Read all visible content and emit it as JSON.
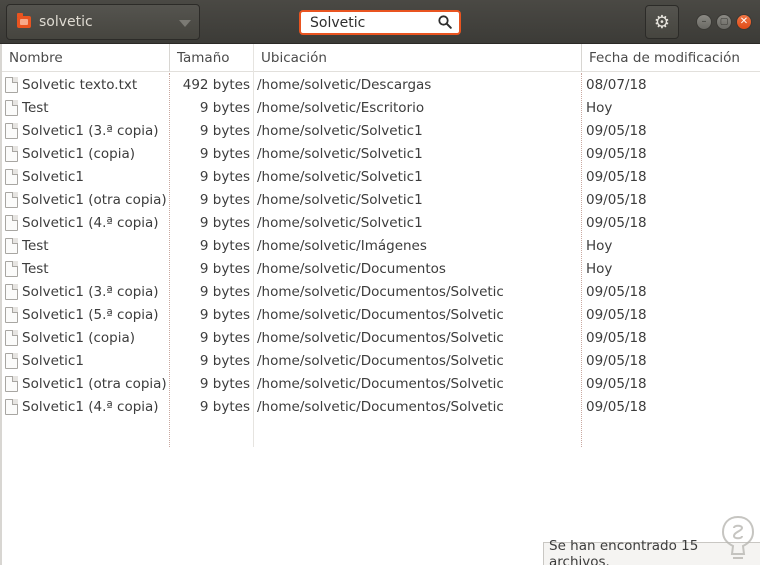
{
  "window": {
    "folder_label": "solvetic",
    "search_value": "Solvetic"
  },
  "columns": {
    "name": "Nombre",
    "size": "Tamaño",
    "location": "Ubicación",
    "modified": "Fecha de modificación"
  },
  "files": [
    {
      "name": "Solvetic texto.txt",
      "size": "492 bytes",
      "location": "/home/solvetic/Descargas",
      "modified": "08/07/18"
    },
    {
      "name": "Test",
      "size": "9 bytes",
      "location": "/home/solvetic/Escritorio",
      "modified": "Hoy"
    },
    {
      "name": "Solvetic1 (3.ª copia)",
      "size": "9 bytes",
      "location": "/home/solvetic/Solvetic1",
      "modified": "09/05/18"
    },
    {
      "name": "Solvetic1 (copia)",
      "size": "9 bytes",
      "location": "/home/solvetic/Solvetic1",
      "modified": "09/05/18"
    },
    {
      "name": "Solvetic1",
      "size": "9 bytes",
      "location": "/home/solvetic/Solvetic1",
      "modified": "09/05/18"
    },
    {
      "name": "Solvetic1 (otra copia)",
      "size": "9 bytes",
      "location": "/home/solvetic/Solvetic1",
      "modified": "09/05/18"
    },
    {
      "name": "Solvetic1 (4.ª copia)",
      "size": "9 bytes",
      "location": "/home/solvetic/Solvetic1",
      "modified": "09/05/18"
    },
    {
      "name": "Test",
      "size": "9 bytes",
      "location": "/home/solvetic/Imágenes",
      "modified": "Hoy"
    },
    {
      "name": "Test",
      "size": "9 bytes",
      "location": "/home/solvetic/Documentos",
      "modified": "Hoy"
    },
    {
      "name": "Solvetic1 (3.ª copia)",
      "size": "9 bytes",
      "location": "/home/solvetic/Documentos/Solvetic",
      "modified": "09/05/18"
    },
    {
      "name": "Solvetic1 (5.ª copia)",
      "size": "9 bytes",
      "location": "/home/solvetic/Documentos/Solvetic",
      "modified": "09/05/18"
    },
    {
      "name": "Solvetic1 (copia)",
      "size": "9 bytes",
      "location": "/home/solvetic/Documentos/Solvetic",
      "modified": "09/05/18"
    },
    {
      "name": "Solvetic1",
      "size": "9 bytes",
      "location": "/home/solvetic/Documentos/Solvetic",
      "modified": "09/05/18"
    },
    {
      "name": "Solvetic1 (otra copia)",
      "size": "9 bytes",
      "location": "/home/solvetic/Documentos/Solvetic",
      "modified": "09/05/18"
    },
    {
      "name": "Solvetic1 (4.ª copia)",
      "size": "9 bytes",
      "location": "/home/solvetic/Documentos/Solvetic",
      "modified": "09/05/18"
    }
  ],
  "status": {
    "text": "Se han encontrado 15 archivos."
  },
  "icons": {
    "folder": "folder-icon",
    "dropdown": "chevron-down-icon",
    "search": "search-icon",
    "settings": "gear-icon",
    "minimize": "minimize-icon",
    "maximize": "maximize-icon",
    "close": "close-icon",
    "file": "text-file-icon",
    "watermark": "solvetic-logo"
  },
  "colors": {
    "accent": "#e95420",
    "headerbar": "#3c3b37"
  }
}
